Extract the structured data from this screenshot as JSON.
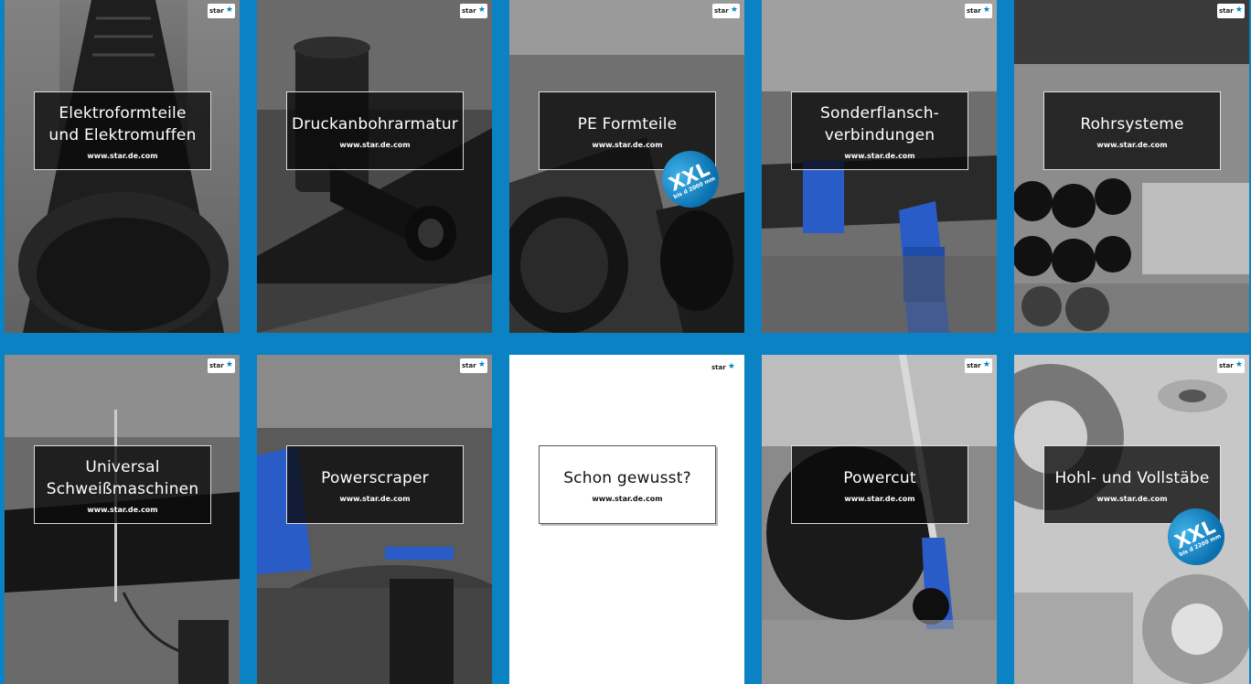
{
  "logo_text": "star",
  "logo_mark": "★",
  "url": "www.star.de.com",
  "cards": [
    {
      "title_lines": [
        "Elektroformteile",
        "und Elektromuffen"
      ]
    },
    {
      "title_lines": [
        "Druckanbohrarmatur"
      ]
    },
    {
      "title_lines": [
        "PE Formteile"
      ],
      "badge": {
        "big": "XXL",
        "small": "bis d 2000 mm"
      }
    },
    {
      "title_lines": [
        "Sonderflansch-",
        "verbindungen"
      ]
    },
    {
      "title_lines": [
        "Rohrsysteme"
      ]
    },
    {
      "title_lines": [
        "Universal",
        "Schweißmaschinen"
      ]
    },
    {
      "title_lines": [
        "Powerscraper"
      ]
    },
    {
      "title_lines": [
        "Schon gewusst?"
      ]
    },
    {
      "title_lines": [
        "Powercut"
      ]
    },
    {
      "title_lines": [
        "Hohl- und Vollstäbe"
      ],
      "badge": {
        "big": "XXL",
        "small": "bis d 2200 mm"
      }
    }
  ],
  "colors": {
    "background": "#0a82c4",
    "badge": "#1a9ad6",
    "accent_blue": "#2a5cc8"
  }
}
